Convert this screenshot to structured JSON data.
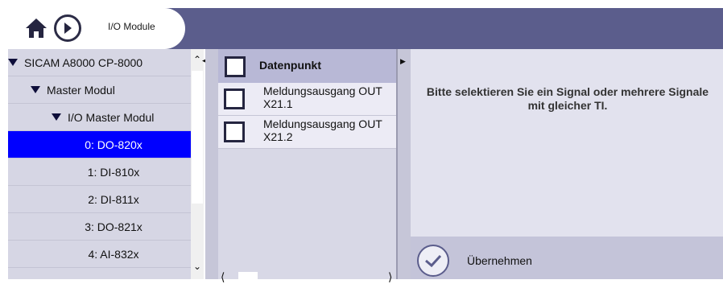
{
  "header": {
    "title": "I/O Module",
    "home_icon": "home-icon",
    "next_icon": "play-right-icon",
    "bar_color": "#5b5d8c"
  },
  "tree": {
    "items": [
      {
        "label": "SICAM A8000 CP-8000",
        "expanded": true
      },
      {
        "label": "Master Modul",
        "expanded": true
      },
      {
        "label": "I/O Master Modul",
        "expanded": true
      },
      {
        "label": "0: DO-820x",
        "selected": true
      },
      {
        "label": "1: DI-810x"
      },
      {
        "label": "2: DI-811x"
      },
      {
        "label": "3: DO-821x"
      },
      {
        "label": "4: AI-832x"
      }
    ],
    "selected_color": "#0000ff"
  },
  "list": {
    "header": "Datenpunkt",
    "rows": [
      {
        "line1": "Meldungsausgang OUT",
        "line2": "X21.1"
      },
      {
        "line1": "Meldungsausgang OUT",
        "line2": "X21.2"
      }
    ]
  },
  "info": {
    "message": "Bitte selektieren Sie ein Signal oder mehrere Signale mit gleicher TI."
  },
  "apply": {
    "label": "Übernehmen",
    "icon": "check-circle-icon"
  }
}
